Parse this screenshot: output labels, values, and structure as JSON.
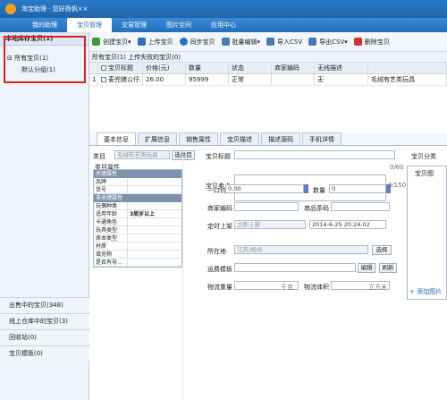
{
  "app": {
    "title": "淘宝助理 · 您好扬帆××"
  },
  "nav": {
    "tabs": [
      "我的助理",
      "宝贝管理",
      "交易管理",
      "图片空间",
      "应用中心"
    ],
    "active": 1
  },
  "left": {
    "header": "本地库存宝贝(1)",
    "tree": [
      {
        "label": "所有宝贝(1)"
      },
      {
        "label": "默认分组(1)"
      }
    ],
    "bottom": [
      "出售中的宝贝(348)",
      "线上仓库中的宝贝(3)",
      "回收站(0)",
      "宝贝模板(0)"
    ]
  },
  "toolbar": {
    "buttons": [
      {
        "label": "创建宝贝",
        "icon": "create-icon",
        "color": "#3a9a3a"
      },
      {
        "label": "上传宝贝",
        "icon": "upload-icon",
        "color": "#2a6fc0"
      },
      {
        "label": "同步宝贝",
        "icon": "sync-icon",
        "color": "#2a6fc0"
      },
      {
        "label": "批量编辑",
        "icon": "batch-edit-icon",
        "color": "#4a79b8"
      },
      {
        "label": "导入CSV",
        "icon": "import-csv-icon",
        "color": "#4a79b8"
      },
      {
        "label": "导出CSV",
        "icon": "export-csv-icon",
        "color": "#4a79b8"
      },
      {
        "label": "删除宝贝",
        "icon": "delete-icon",
        "color": "#d03030"
      }
    ]
  },
  "list": {
    "header": "所有宝贝(1)    上传失败的宝贝(0)",
    "columns": [
      "宝贝标题",
      "价格(元)",
      "数量",
      "状态",
      "商家编码",
      "无线描述",
      ""
    ],
    "rows": [
      {
        "idx": "1",
        "title": "麦兜猪公仔…",
        "price": "26.00",
        "qty": "95999",
        "status": "正常",
        "code": "",
        "wireless": "无",
        "extra": "毛绒有艺类玩具"
      }
    ]
  },
  "tabs": [
    "基本信息",
    "扩展信息",
    "销售属性",
    "宝贝描述",
    "描述源码",
    "手机详情"
  ],
  "form": {
    "category_label": "类目",
    "category_value": "毛绒布艺类玩具",
    "category_btn": "选类目",
    "attr_title": "类目属性",
    "attr_key_section": "关键属性",
    "attr_key_rows": [
      {
        "k": "品牌",
        "v": ""
      },
      {
        "k": "货号",
        "v": ""
      }
    ],
    "attr_nonkey_section": "非关键属性",
    "attr_rows": [
      {
        "k": "玩偶种类",
        "v": ""
      },
      {
        "k": "适用年龄",
        "v": "3周岁以上"
      },
      {
        "k": "卡通角色",
        "v": ""
      },
      {
        "k": "玩具类型",
        "v": ""
      },
      {
        "k": "原本类型",
        "v": ""
      },
      {
        "k": "材质",
        "v": ""
      },
      {
        "k": "填充物",
        "v": ""
      },
      {
        "k": "是否有导…",
        "v": ""
      }
    ],
    "title_label": "宝贝标题",
    "title_count": "0/60",
    "category2_label": "宝贝分类",
    "selling_label": "宝贝卖点",
    "selling_count": "0/150",
    "price_label": "一口价",
    "price_value": "0.00",
    "qty_label": "数量",
    "qty_value": "0",
    "code_label": "商家编码",
    "barcode_label": "商品条码",
    "schedule_label": "定时上架",
    "schedule_mode": "立即上架",
    "schedule_time": "2014-6-25 20:24:02",
    "location_label": "所在地",
    "location_value": "江苏/扬州",
    "location_btn": "选择",
    "shipping_label": "运费模板",
    "shipping_edit": "编辑",
    "shipping_refresh": "刷新",
    "weight_label": "物流重量",
    "weight_unit": "千克",
    "volume_label": "物流体积",
    "volume_unit": "立方米",
    "right_label": "宝贝图",
    "add_image": "+ 添加图片"
  }
}
